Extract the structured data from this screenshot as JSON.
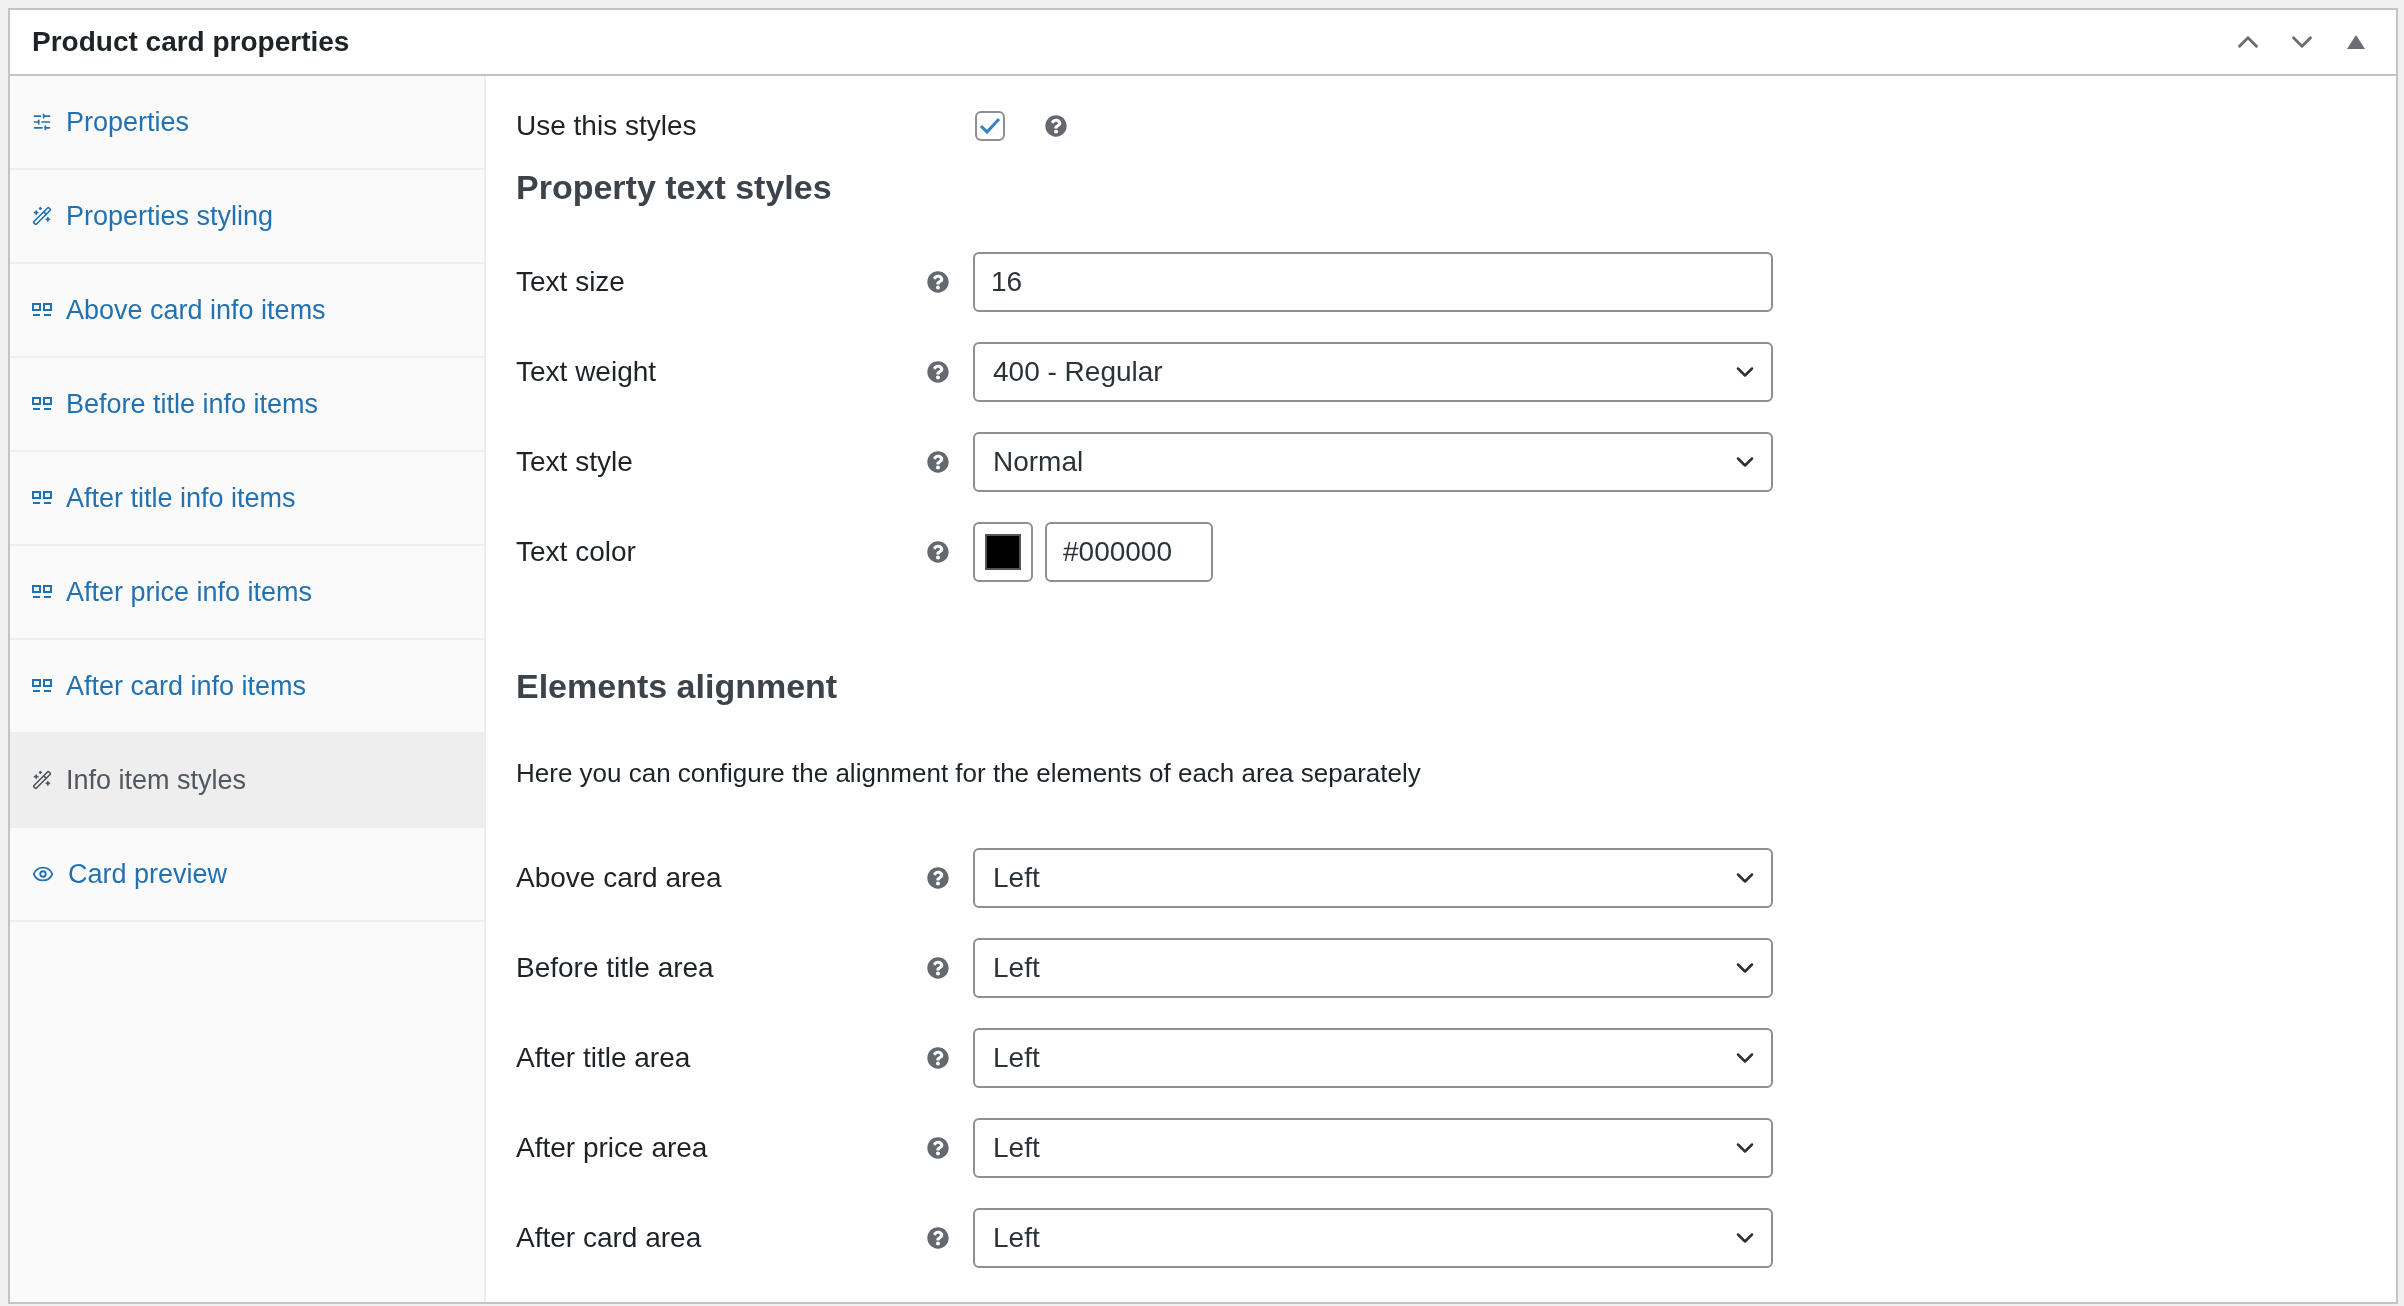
{
  "panel": {
    "title": "Product card properties"
  },
  "sidebar": {
    "items": [
      {
        "label": "Properties",
        "kind": "settings",
        "selected": false
      },
      {
        "label": "Properties styling",
        "kind": "styling",
        "selected": false
      },
      {
        "label": "Above card info items",
        "kind": "items",
        "selected": false
      },
      {
        "label": "Before title info items",
        "kind": "items",
        "selected": false
      },
      {
        "label": "After title info items",
        "kind": "items",
        "selected": false
      },
      {
        "label": "After price info items",
        "kind": "items",
        "selected": false
      },
      {
        "label": "After card info items",
        "kind": "items",
        "selected": false
      },
      {
        "label": "Info item styles",
        "kind": "styling",
        "selected": true
      },
      {
        "label": "Card preview",
        "kind": "preview",
        "selected": false
      }
    ]
  },
  "use_styles": {
    "label": "Use this styles",
    "checked": true
  },
  "sections": [
    {
      "heading": "Property text styles",
      "fields": [
        {
          "kind": "text",
          "label": "Text size",
          "value": "16"
        },
        {
          "kind": "select",
          "label": "Text weight",
          "value": "400 - Regular"
        },
        {
          "kind": "select",
          "label": "Text style",
          "value": "Normal"
        },
        {
          "kind": "color",
          "label": "Text color",
          "value": "#000000",
          "color": "#000000"
        }
      ]
    },
    {
      "heading": "Elements alignment",
      "description": "Here you can configure the alignment for the elements of each area separately",
      "fields": [
        {
          "kind": "select",
          "label": "Above card area",
          "value": "Left"
        },
        {
          "kind": "select",
          "label": "Before title area",
          "value": "Left"
        },
        {
          "kind": "select",
          "label": "After title area",
          "value": "Left"
        },
        {
          "kind": "select",
          "label": "After price area",
          "value": "Left"
        },
        {
          "kind": "select",
          "label": "After card area",
          "value": "Left"
        }
      ]
    }
  ]
}
